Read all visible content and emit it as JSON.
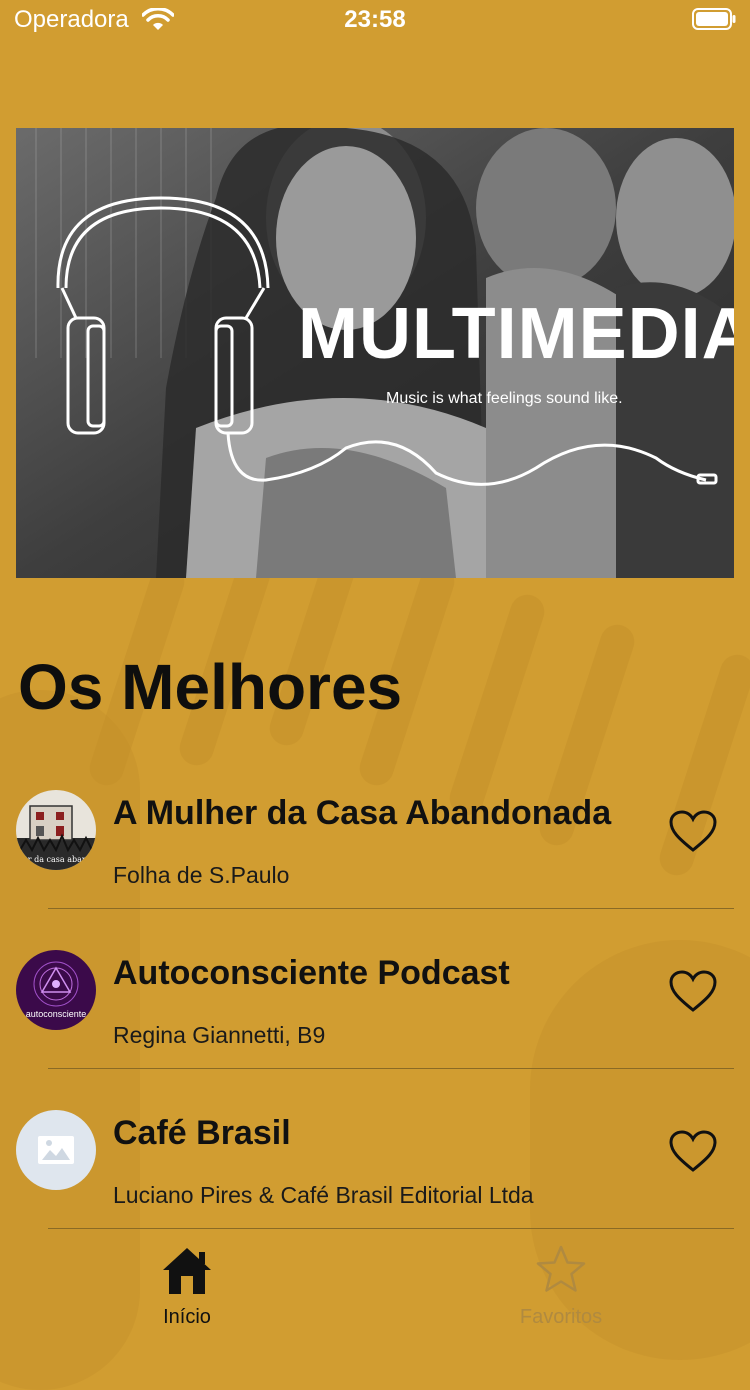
{
  "status_bar": {
    "carrier": "Operadora",
    "time": "23:58"
  },
  "banner": {
    "title": "MULTIMEDIA",
    "tagline": "Music is what feelings sound like."
  },
  "section": {
    "title": "Os Melhores"
  },
  "podcasts": [
    {
      "title": "A Mulher da Casa Abandonada",
      "author": "Folha de S.Paulo",
      "favorited": false,
      "avatar_text": "a mulher da casa abandonada"
    },
    {
      "title": "Autoconsciente Podcast",
      "author": "Regina Giannetti, B9",
      "favorited": false,
      "avatar_text": "autoconsciente"
    },
    {
      "title": "Café Brasil",
      "author": "Luciano Pires & Café Brasil Editorial Ltda",
      "favorited": false,
      "avatar_text": ""
    }
  ],
  "tab_bar": {
    "tabs": [
      {
        "label": "Início",
        "icon": "home-icon",
        "active": true
      },
      {
        "label": "Favoritos",
        "icon": "star-icon",
        "active": false
      }
    ]
  },
  "colors": {
    "background": "#d19d31",
    "text": "#111111",
    "inactive_tab": "#b08a40"
  }
}
